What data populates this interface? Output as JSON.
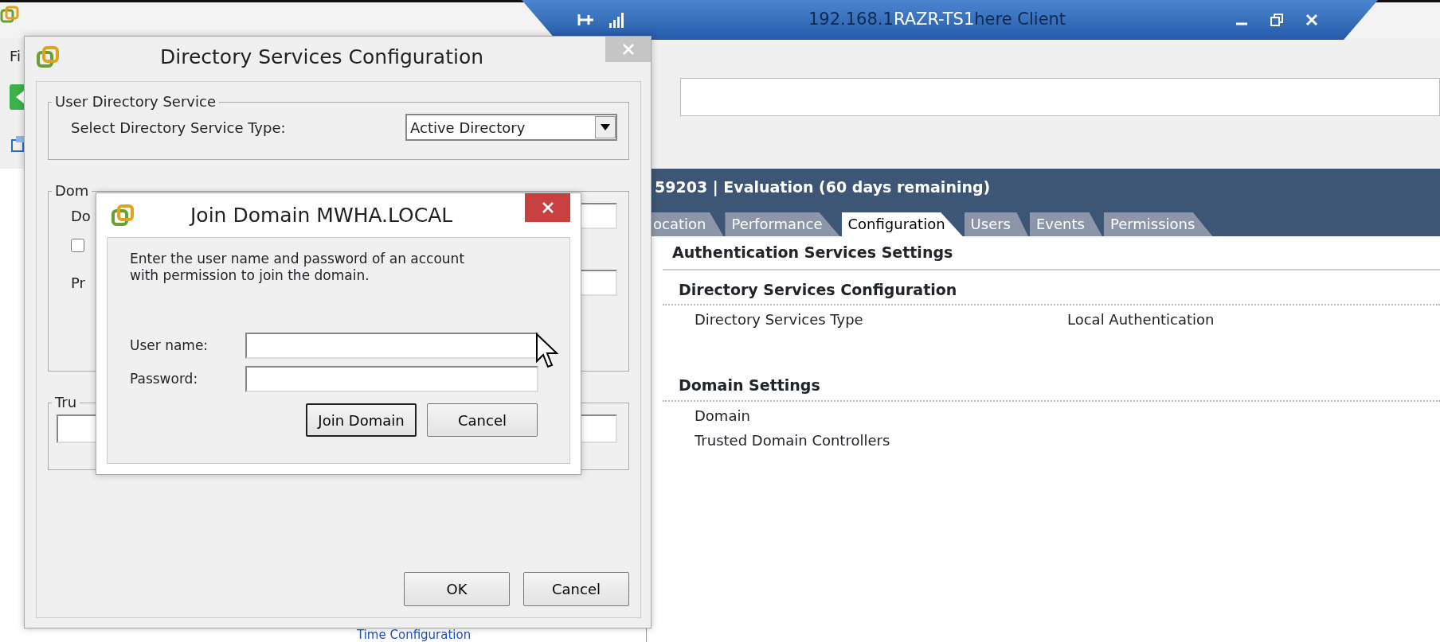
{
  "remote_bar": {
    "host_start": "192.168.1",
    "title": "RAZR-TS1",
    "host_end": "here Client"
  },
  "app": {
    "menu": [
      "Fi"
    ],
    "header": "59203 | Evaluation (60 days remaining)",
    "tabs": [
      {
        "label": "ocation",
        "selected": false
      },
      {
        "label": "Performance",
        "selected": false
      },
      {
        "label": "Configuration",
        "selected": true
      },
      {
        "label": "Users",
        "selected": false
      },
      {
        "label": "Events",
        "selected": false
      },
      {
        "label": "Permissions",
        "selected": false
      }
    ],
    "section_title": "Authentication Services Settings",
    "groups": [
      {
        "title": "Directory Services Configuration",
        "rows": [
          {
            "label": "Directory Services Type",
            "value": "Local Authentication"
          }
        ]
      },
      {
        "title": "Domain Settings",
        "rows": [
          {
            "label": "Domain"
          },
          {
            "label": "Trusted Domain Controllers"
          }
        ]
      }
    ],
    "tree_link": "Time Configuration"
  },
  "directory_dialog": {
    "title": "Directory Services Configuration",
    "fieldset_1": {
      "legend": "User Directory Service",
      "label": "Select Directory Service Type:",
      "value": "Active Directory"
    },
    "fieldset_2": {
      "legend": "Dom",
      "domain_label": "Do",
      "checked": false,
      "proxy_label": "Pr"
    },
    "fieldset_3": {
      "legend": "Tru"
    },
    "buttons": [
      "OK",
      "Cancel"
    ]
  },
  "join_dialog": {
    "title": "Join Domain MWHA.LOCAL",
    "message": "Enter the user name and password of an account with permission to join the domain.",
    "fields": [
      {
        "label": "User name:"
      },
      {
        "label": "Password:"
      }
    ],
    "buttons": [
      "Join Domain",
      "Cancel"
    ]
  }
}
